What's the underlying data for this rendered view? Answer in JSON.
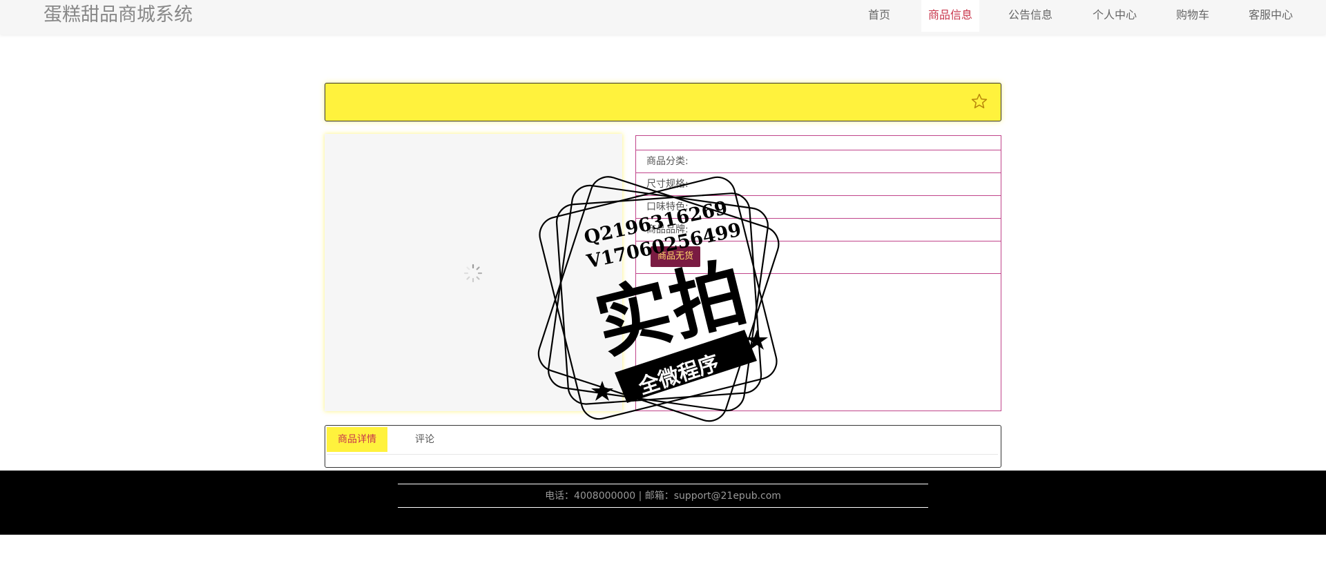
{
  "header": {
    "brand": "蛋糕甜品商城系统",
    "nav": [
      {
        "label": "首页",
        "active": false
      },
      {
        "label": "商品信息",
        "active": true
      },
      {
        "label": "公告信息",
        "active": false
      },
      {
        "label": "个人中心",
        "active": false
      },
      {
        "label": "购物车",
        "active": false
      },
      {
        "label": "客服中心",
        "active": false
      }
    ]
  },
  "product": {
    "name": "",
    "favorite_icon": "star-outline-icon",
    "image_state": "loading-spinner-icon",
    "fields": [
      {
        "label": ""
      },
      {
        "label": "商品分类:"
      },
      {
        "label": "尺寸规格:"
      },
      {
        "label": "口味特色:"
      },
      {
        "label": "商品品牌:"
      }
    ],
    "stock_status": "商品无货"
  },
  "tabs": [
    {
      "label": "商品详情",
      "active": true
    },
    {
      "label": "评论",
      "active": false
    }
  ],
  "footer": {
    "contact": "电话：4008000000 | 邮箱：support@21epub.com"
  },
  "watermark": {
    "line1": "Q2196316269",
    "line2": "V17060256499",
    "main": "实拍",
    "banner": "全微程序"
  },
  "colors": {
    "accent_yellow": "#fff23d",
    "active_red": "#c8354b",
    "panel_border": "#c0438a",
    "badge_bg": "#7a1b42",
    "badge_text": "#ffd66b",
    "footer_bg": "#000000"
  }
}
